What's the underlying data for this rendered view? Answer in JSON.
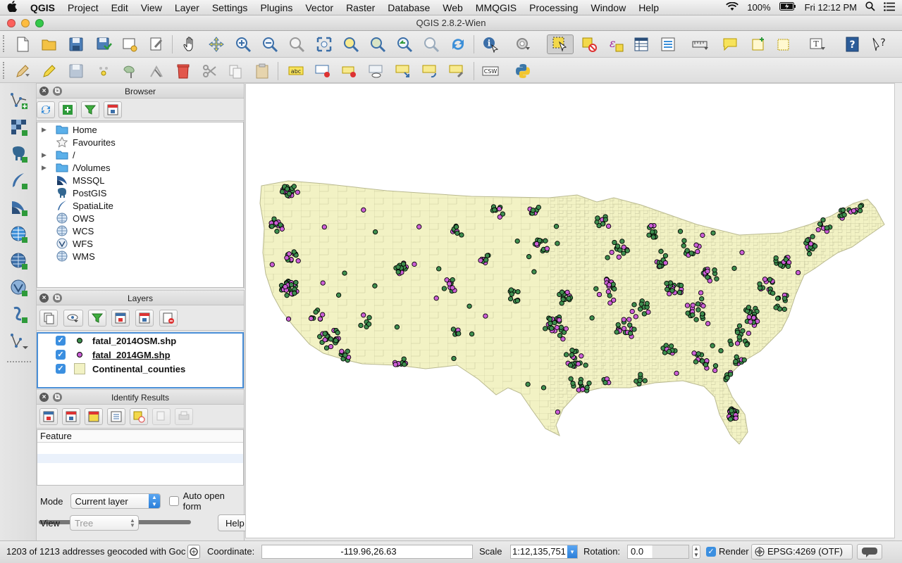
{
  "menubar": {
    "items": [
      "QGIS",
      "Project",
      "Edit",
      "View",
      "Layer",
      "Settings",
      "Plugins",
      "Vector",
      "Raster",
      "Database",
      "Web",
      "MMQGIS",
      "Processing",
      "Window",
      "Help"
    ],
    "battery": "100%",
    "clock": "Fri 12:12 PM"
  },
  "window": {
    "title": "QGIS 2.8.2-Wien"
  },
  "toolbar_labels": {
    "abc": "abc",
    "csw": "CSW"
  },
  "browser": {
    "title": "Browser",
    "items": [
      {
        "label": "Home",
        "icon": "folder-icon",
        "expandable": true
      },
      {
        "label": "Favourites",
        "icon": "star-icon",
        "expandable": false
      },
      {
        "label": "/",
        "icon": "folder-icon",
        "expandable": true
      },
      {
        "label": "/Volumes",
        "icon": "folder-icon",
        "expandable": true
      },
      {
        "label": "MSSQL",
        "icon": "mssql-icon",
        "expandable": false
      },
      {
        "label": "PostGIS",
        "icon": "postgis-elephant-icon",
        "expandable": false
      },
      {
        "label": "SpatiaLite",
        "icon": "spatialite-feather-icon",
        "expandable": false
      },
      {
        "label": "OWS",
        "icon": "globe-icon",
        "expandable": false
      },
      {
        "label": "WCS",
        "icon": "globe-icon",
        "expandable": false
      },
      {
        "label": "WFS",
        "icon": "wfs-icon",
        "expandable": false
      },
      {
        "label": "WMS",
        "icon": "globe-icon",
        "expandable": false
      }
    ]
  },
  "layers": {
    "title": "Layers",
    "items": [
      {
        "name": "fatal_2014OSM.shp",
        "checked": true,
        "symbol_color": "#3e8e4e",
        "symbol": "point"
      },
      {
        "name": "fatal_2014GM.shp",
        "checked": true,
        "symbol_color": "#cc5fd6",
        "symbol": "point"
      },
      {
        "name": "Continental_counties",
        "checked": true,
        "symbol_color": "#f2f2c4",
        "symbol": "polygon"
      }
    ]
  },
  "identify": {
    "title": "Identify Results",
    "column_header": "Feature",
    "mode_label": "Mode",
    "mode_value": "Current layer",
    "auto_open_label": "Auto open form",
    "view_label": "View",
    "view_value": "Tree",
    "help_button": "Help"
  },
  "map": {
    "land_color": "#f2f2c4",
    "border_color": "#b9b98f",
    "osm_point_color": "#3e8e4e",
    "gm_point_color": "#cc5fd6"
  },
  "status": {
    "message": "1203 of 1213 addresses geocoded with Goc",
    "coordinate_label": "Coordinate:",
    "coordinate_value": "-119.96,26.63",
    "scale_label": "Scale",
    "scale_value": "1:12,135,751",
    "rotation_label": "Rotation:",
    "rotation_value": "0.0",
    "render_label": "Render",
    "crs": "EPSG:4269 (OTF)"
  }
}
